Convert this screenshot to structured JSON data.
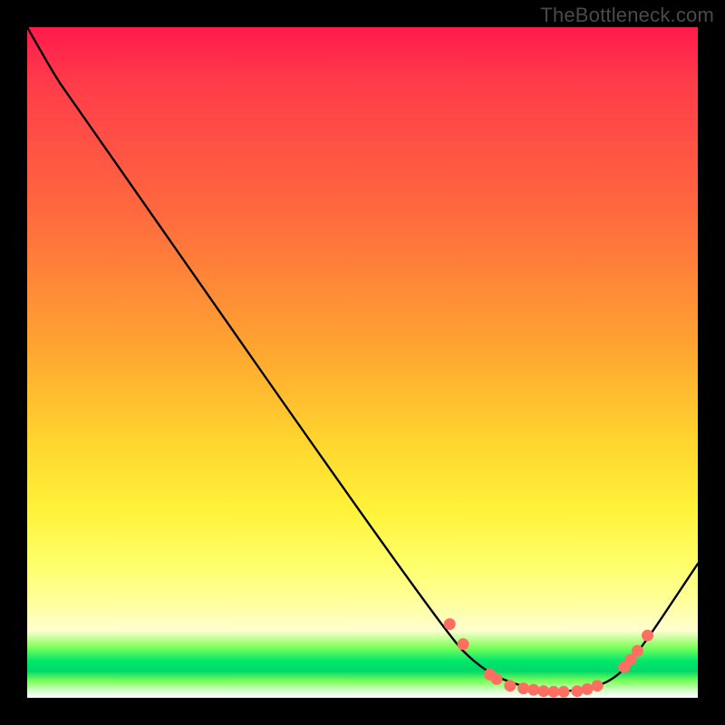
{
  "watermark": "TheBottleneck.com",
  "chart_data": {
    "type": "line",
    "title": "",
    "xlabel": "",
    "ylabel": "",
    "x_range": [
      0,
      100
    ],
    "y_range": [
      0,
      100
    ],
    "curve": [
      {
        "x": 0,
        "y": 100
      },
      {
        "x": 4,
        "y": 93
      },
      {
        "x": 6,
        "y": 90
      },
      {
        "x": 62,
        "y": 10
      },
      {
        "x": 68,
        "y": 4
      },
      {
        "x": 74,
        "y": 1.5
      },
      {
        "x": 80,
        "y": 0.8
      },
      {
        "x": 86,
        "y": 1.8
      },
      {
        "x": 90,
        "y": 5
      },
      {
        "x": 100,
        "y": 20
      }
    ],
    "markers": [
      {
        "x": 63,
        "y": 11
      },
      {
        "x": 65,
        "y": 8
      },
      {
        "x": 69,
        "y": 3.5
      },
      {
        "x": 70,
        "y": 2.8
      },
      {
        "x": 72,
        "y": 1.8
      },
      {
        "x": 74,
        "y": 1.4
      },
      {
        "x": 75.5,
        "y": 1.2
      },
      {
        "x": 77,
        "y": 1.0
      },
      {
        "x": 78.5,
        "y": 0.9
      },
      {
        "x": 80,
        "y": 0.9
      },
      {
        "x": 82,
        "y": 1.0
      },
      {
        "x": 83.5,
        "y": 1.3
      },
      {
        "x": 85,
        "y": 1.8
      },
      {
        "x": 89,
        "y": 4.6
      },
      {
        "x": 90,
        "y": 5.7
      },
      {
        "x": 91,
        "y": 7.0
      },
      {
        "x": 92.5,
        "y": 9.3
      }
    ],
    "marker_color": "#ff6f61",
    "background_gradient": [
      "#ff1a4d",
      "#ffd62e",
      "#ffff6a",
      "#00e86b"
    ]
  }
}
